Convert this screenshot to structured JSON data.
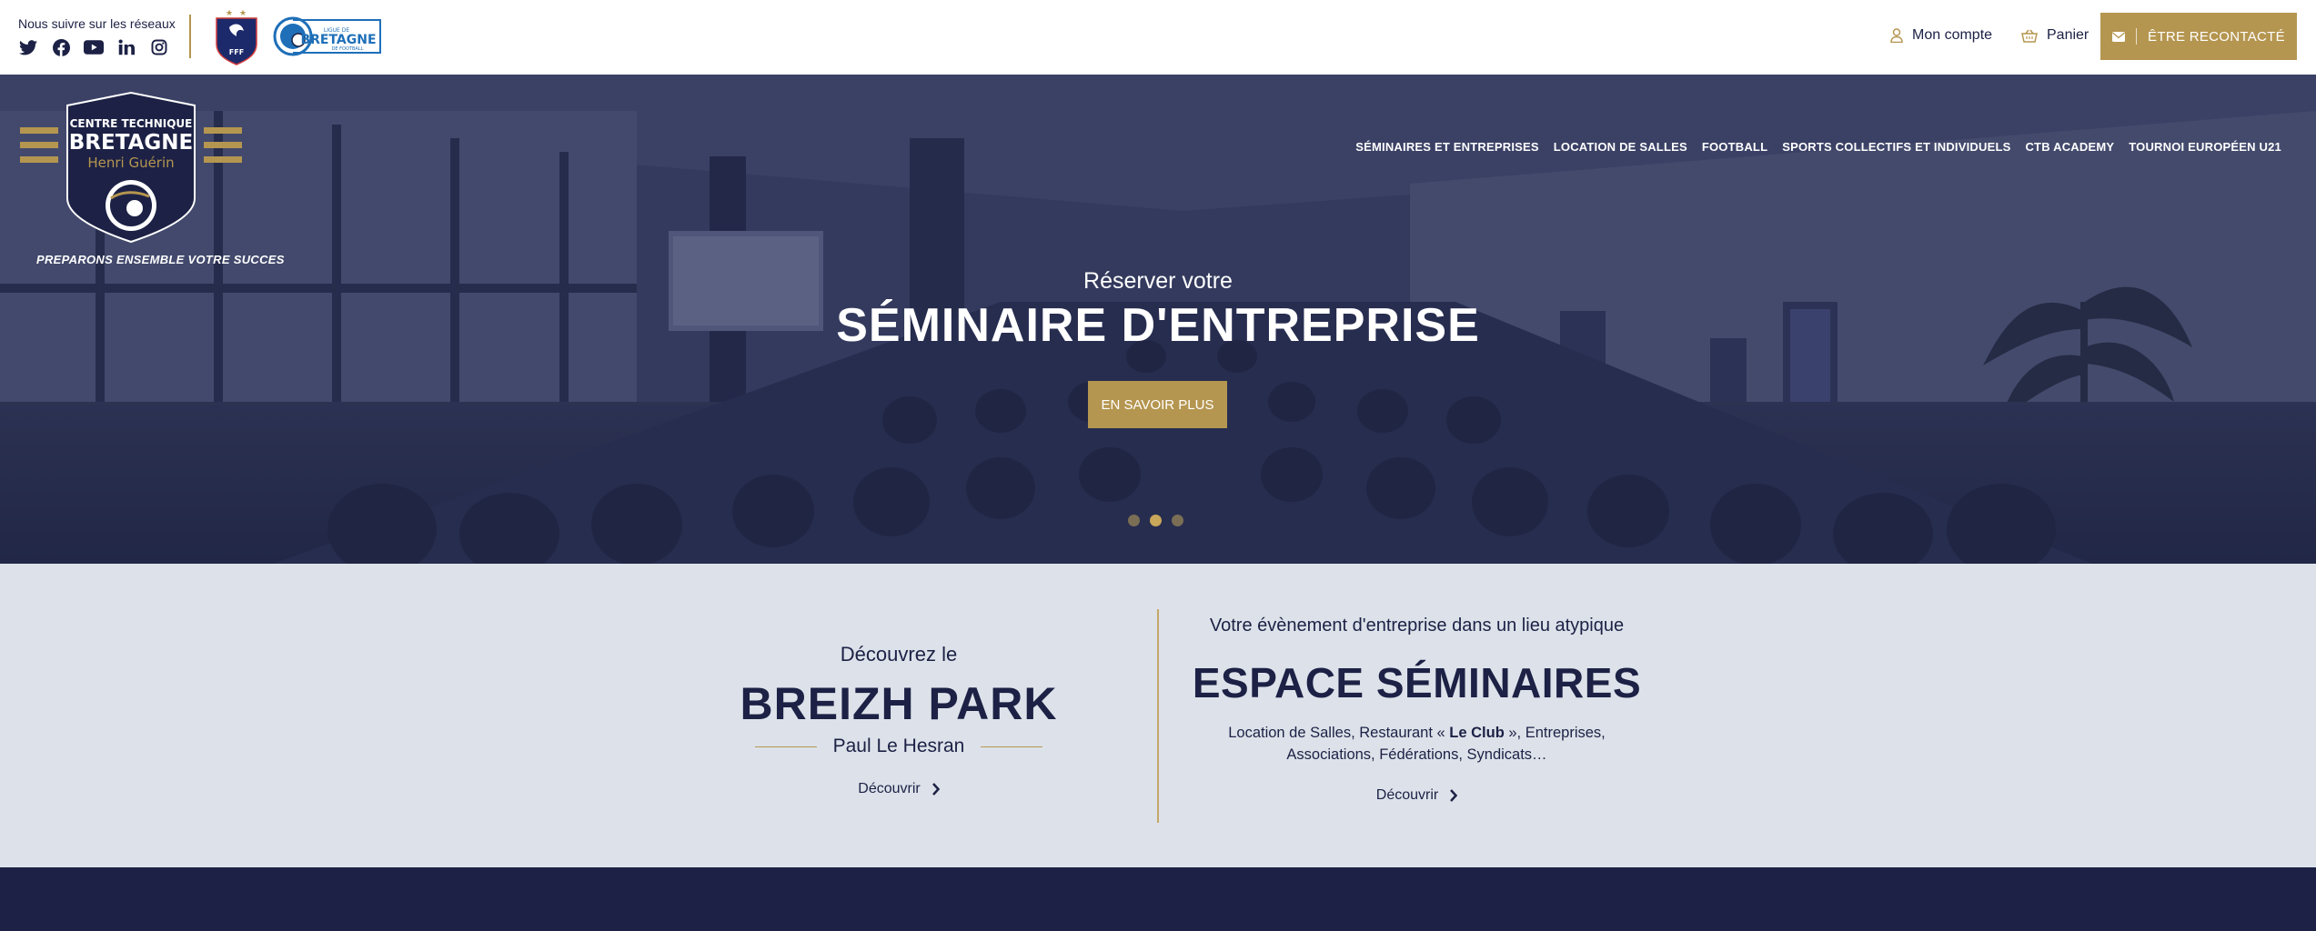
{
  "colors": {
    "navy": "#1c2145",
    "gold": "#b59650",
    "light_bg": "#dde2ea"
  },
  "topbar": {
    "social_label": "Nous suivre sur les réseaux",
    "social_icons": [
      "twitter-icon",
      "facebook-icon",
      "youtube-icon",
      "linkedin-icon",
      "instagram-icon"
    ],
    "account_label": "Mon compte",
    "cart_label": "Panier",
    "contact_label": "ÊTRE RECONTACTÉ"
  },
  "brand": {
    "line1": "CENTRE TECHNIQUE",
    "line2": "BRETAGNE",
    "line3": "Henri Guérin",
    "tagline": "PREPARONS ENSEMBLE VOTRE SUCCES"
  },
  "nav": {
    "items": [
      "SÉMINAIRES ET ENTREPRISES",
      "LOCATION DE SALLES",
      "FOOTBALL",
      "SPORTS COLLECTIFS ET INDIVIDUELS",
      "CTB ACADEMY",
      "TOURNOI EUROPÉEN U21"
    ]
  },
  "hero": {
    "kicker": "Réserver votre",
    "title": "SÉMINAIRE D'ENTREPRISE",
    "button": "EN SAVOIR PLUS",
    "slides": 3,
    "active_slide": 2
  },
  "features": {
    "left": {
      "kicker": "Découvrez le",
      "title": "BREIZH PARK",
      "subtitle": "Paul Le Hesran",
      "link": "Découvrir"
    },
    "right": {
      "kicker": "Votre évènement d'entreprise dans un lieu atypique",
      "title": "ESPACE SÉMINAIRES",
      "desc_before": "Location de Salles, Restaurant « ",
      "desc_bold": "Le Club",
      "desc_after": " », Entreprises, Associations, Fédérations, Syndicats…",
      "link": "Découvrir"
    }
  }
}
